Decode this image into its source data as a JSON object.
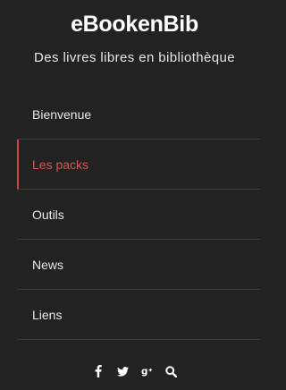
{
  "header": {
    "title": "eBookenBib",
    "subtitle": "Des livres libres en bibliothèque"
  },
  "nav": {
    "items": [
      {
        "label": "Bienvenue",
        "active": false
      },
      {
        "label": "Les packs",
        "active": true
      },
      {
        "label": "Outils",
        "active": false
      },
      {
        "label": "News",
        "active": false
      },
      {
        "label": "Liens",
        "active": false
      }
    ]
  },
  "social": {
    "icons": [
      "facebook-icon",
      "twitter-icon",
      "google-plus-icon",
      "search-icon"
    ]
  },
  "colors": {
    "background": "#222222",
    "accent": "#d9534f",
    "text": "#ffffff"
  }
}
